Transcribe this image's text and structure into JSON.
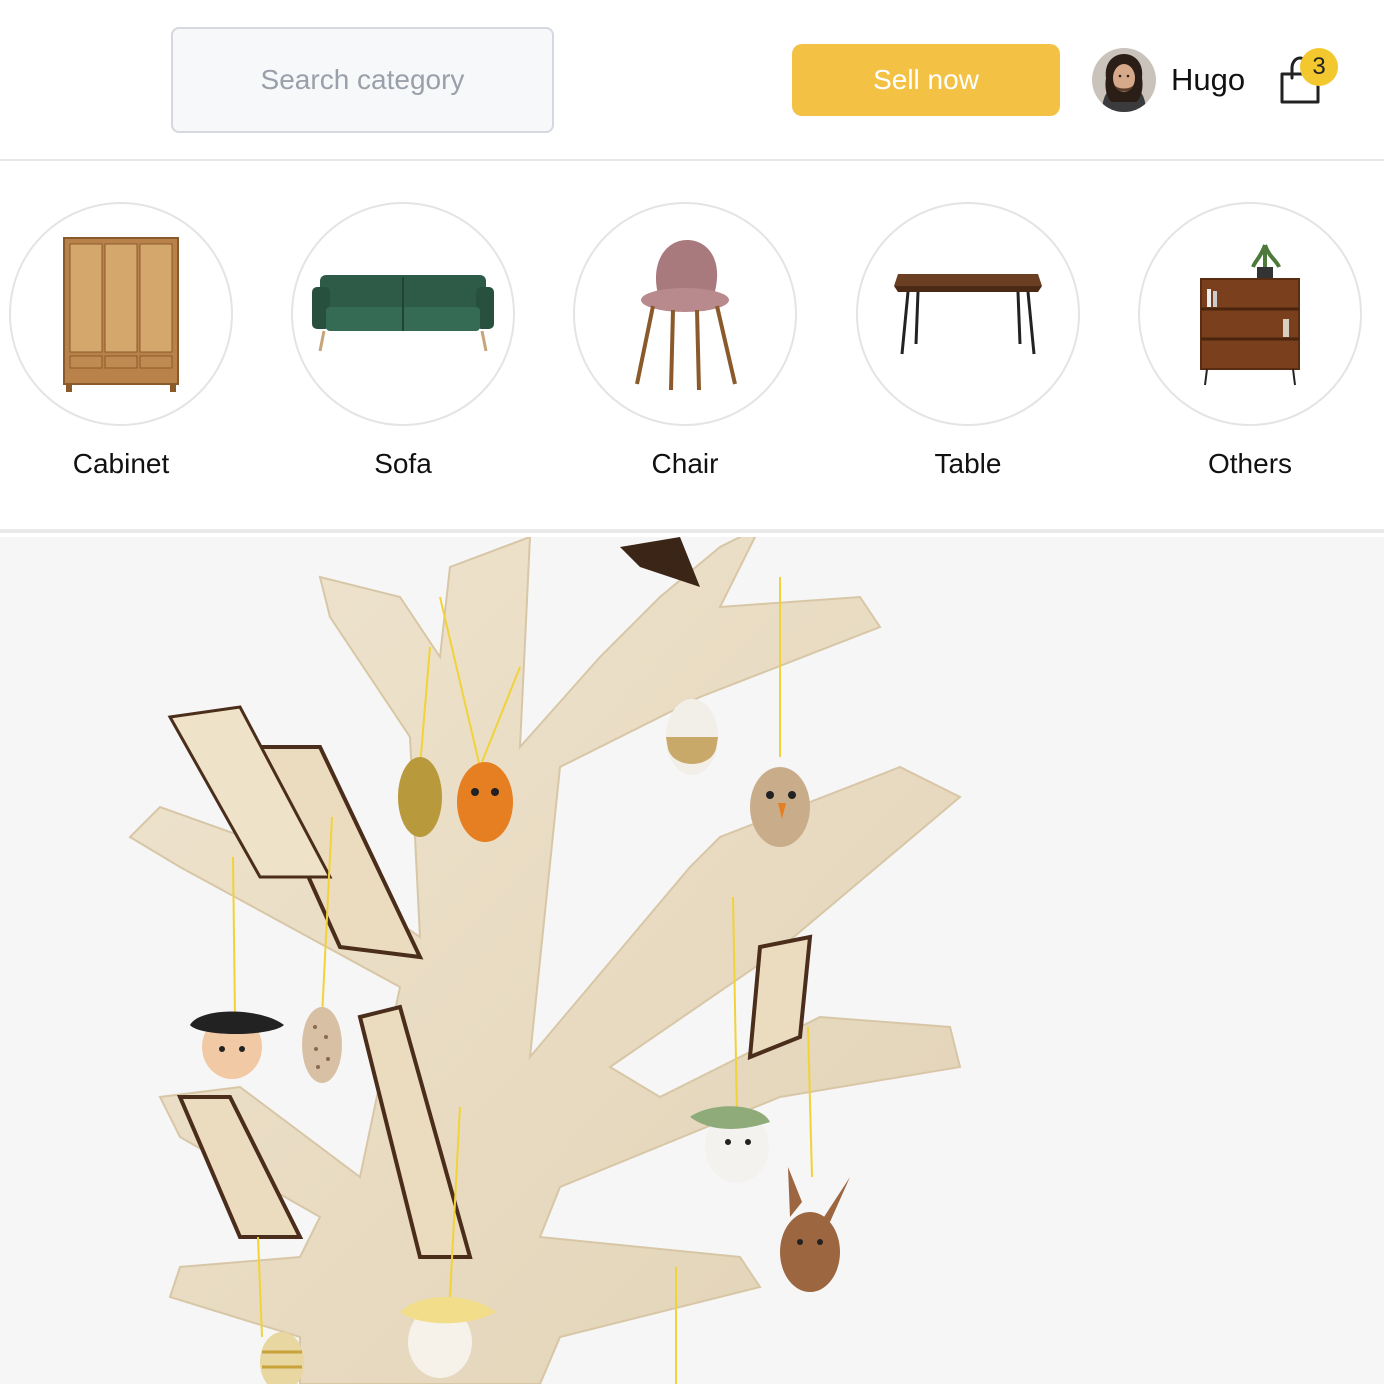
{
  "header": {
    "search": {
      "placeholder": "Search category",
      "icon": "search-field"
    },
    "sell_button_label": "Sell now",
    "user": {
      "name": "Hugo",
      "avatar_icon": "user-avatar"
    },
    "cart": {
      "count": "3",
      "icon": "shopping-bag-icon"
    }
  },
  "categories": [
    {
      "label": "Cabinet",
      "icon": "cabinet-icon"
    },
    {
      "label": "Sofa",
      "icon": "sofa-icon"
    },
    {
      "label": "Chair",
      "icon": "chair-icon"
    },
    {
      "label": "Table",
      "icon": "table-icon"
    },
    {
      "label": "Others",
      "icon": "shelf-icon"
    }
  ],
  "hero": {
    "image": "wooden-easter-tree-with-ornaments"
  },
  "colors": {
    "accent": "#f3c244",
    "badge": "#f3c82e",
    "hero_background": "#f6f6f6",
    "divider": "#e6e6e6"
  }
}
